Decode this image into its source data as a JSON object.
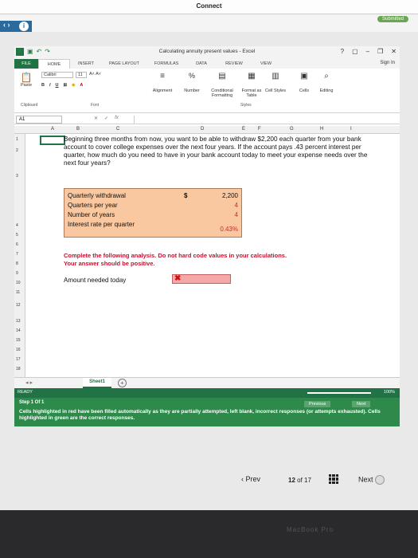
{
  "app": {
    "title": "Connect",
    "status": "Submitted"
  },
  "excel": {
    "window_title": "Calculating annuity present values - Excel",
    "win_help": "?",
    "sign_in": "Sign In",
    "tabs": [
      "FILE",
      "HOME",
      "INSERT",
      "PAGE LAYOUT",
      "FORMULAS",
      "DATA",
      "REVIEW",
      "VIEW"
    ],
    "ribbon": {
      "font_name": "Calibri",
      "font_size": "11",
      "bold": "B",
      "italic": "I",
      "underline": "U",
      "percent": "%",
      "paste": "Paste",
      "alignment": "Alignment",
      "number": "Number",
      "conditional": "Conditional Formatting",
      "format_table": "Format as Table",
      "cell_styles": "Cell Styles",
      "cells": "Cells",
      "editing": "Editing",
      "clipboard_label": "Clipboard",
      "font_label": "Font",
      "styles_label": "Styles"
    },
    "name_box": "A1",
    "fx": "fx",
    "columns": [
      "A",
      "B",
      "C",
      "D",
      "E",
      "F",
      "G",
      "H",
      "I"
    ],
    "rows": [
      "1",
      "2",
      "3",
      "4",
      "5",
      "6",
      "7",
      "8",
      "9",
      "10",
      "11",
      "12",
      "13",
      "14",
      "15",
      "16",
      "17",
      "18"
    ],
    "problem_text": "Beginning three months from now, you want to be able to withdraw $2,200 each quarter from your bank account to cover college expenses over the next four years. If the account pays .43 percent interest per quarter, how much do you need to have in your bank account today to meet your expense needs over the next four years?",
    "inputs": [
      {
        "label": "Quarterly withdrawal",
        "dollar": "$",
        "value": "2,200"
      },
      {
        "label": "Quarters per year",
        "dollar": "",
        "value": "4"
      },
      {
        "label": "Number of years",
        "dollar": "",
        "value": "4"
      },
      {
        "label": "Interest rate per quarter",
        "dollar": "",
        "value": "0.43%"
      }
    ],
    "instruction_line1": "Complete the following analysis. Do not hard code values in your calculations.",
    "instruction_line2": "Your answer should be positive.",
    "amount_label": "Amount needed today",
    "amount_mark": "✖",
    "sheet_tab": "Sheet1",
    "add_sheet": "+",
    "status_ready": "READY",
    "zoom": "100%"
  },
  "step": {
    "label": "Step 1 Of 1",
    "message": "Cells highlighted in red have been filled automatically as they are partially attempted, left blank, incorrect responses (or attempts exhausted). Cells highlighted in green are the correct responses.",
    "prev": "Previous",
    "next": "Next"
  },
  "nav": {
    "prev": "‹ Prev",
    "current": "12",
    "of": "of",
    "total": "17",
    "next": "Next"
  },
  "bezel": "MacBook Pro"
}
